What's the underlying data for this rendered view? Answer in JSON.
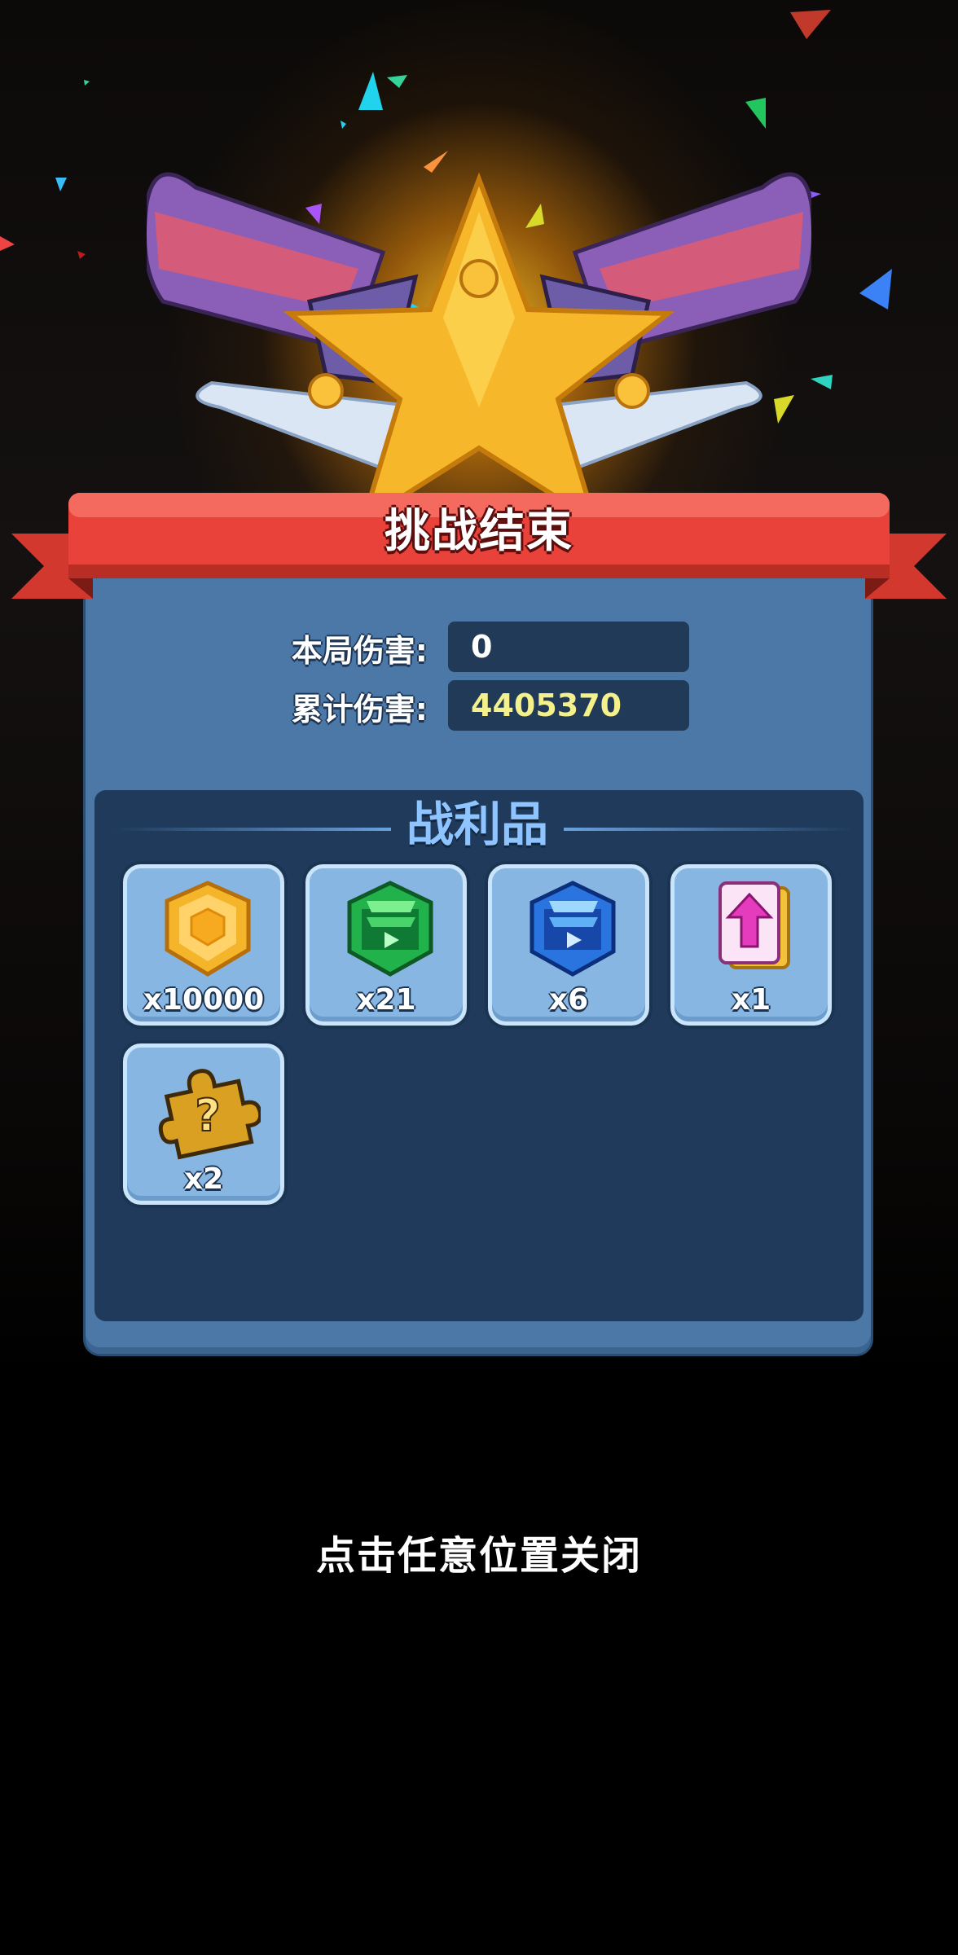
{
  "header": {
    "title": "挑战结束"
  },
  "stats": {
    "round_damage_label": "本局伤害:",
    "round_damage_value": "0",
    "total_damage_label": "累计伤害:",
    "total_damage_value": "4405370"
  },
  "loot": {
    "title": "战利品",
    "items": [
      {
        "icon": "gold-coin-icon",
        "count": "x10000"
      },
      {
        "icon": "green-gem-icon",
        "count": "x21"
      },
      {
        "icon": "blue-gem-icon",
        "count": "x6"
      },
      {
        "icon": "upgrade-card-icon",
        "count": "x1"
      },
      {
        "icon": "mystery-puzzle-icon",
        "count": "x2"
      }
    ]
  },
  "footer": {
    "close_hint": "点击任意位置关闭"
  },
  "colors": {
    "ribbon": "#e8423a",
    "panel": "#4c78a8",
    "loot_bg": "#1f3a5b",
    "item_bg": "#87b6e2",
    "highlight_value": "#f4f08c"
  }
}
